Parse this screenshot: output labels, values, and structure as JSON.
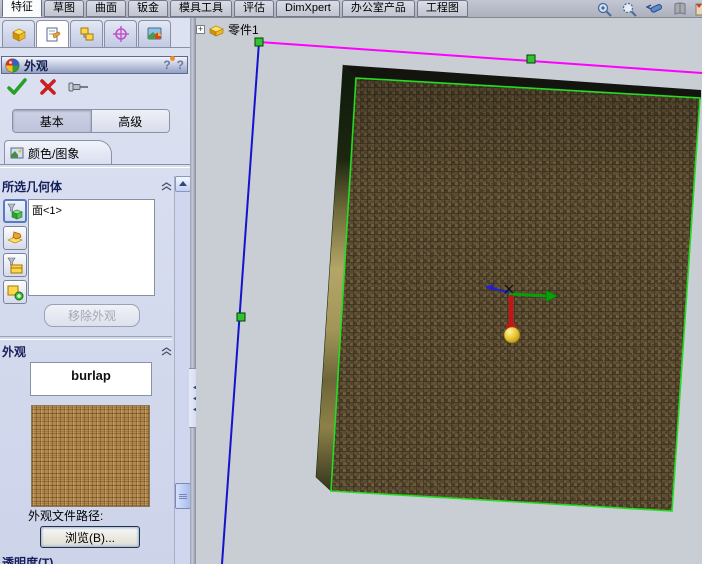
{
  "ribbon": {
    "tabs": [
      {
        "label": "特征",
        "active": true
      },
      {
        "label": "草图",
        "active": false
      },
      {
        "label": "曲面",
        "active": false
      },
      {
        "label": "钣金",
        "active": false
      },
      {
        "label": "模具工具",
        "active": false
      },
      {
        "label": "评估",
        "active": false
      },
      {
        "label": "DimXpert",
        "active": false
      },
      {
        "label": "办公室产品",
        "active": false
      },
      {
        "label": "工程图",
        "active": false
      }
    ],
    "tool_icons": [
      "zoom-in",
      "zoom-to-area",
      "fly-through",
      "appearance-book",
      "texture-file"
    ]
  },
  "panel": {
    "manager_tabs": [
      "feature-manager",
      "property-manager",
      "configuration-manager",
      "dimxpert-manager",
      "display-manager"
    ],
    "active_manager_tab": "property-manager",
    "title": "外观",
    "help_icons": [
      "flyout-help",
      "help"
    ],
    "action_icons": [
      "ok-check",
      "cancel-x",
      "pushpin"
    ],
    "modes": {
      "basic": "基本",
      "advanced": "高级",
      "active": "基本"
    },
    "subtab": "颜色/图象",
    "selected_geometry": {
      "header": "所选几何体",
      "items": [
        "面<1>"
      ],
      "filter_icons": [
        "filter-solid",
        "select-face",
        "filter-body",
        "add-selection"
      ],
      "remove_button": "移除外观",
      "remove_enabled": false
    },
    "appearance": {
      "header": "外观",
      "texture_name": "burlap",
      "path_label": "外观文件路径:",
      "browse_button": "浏览(B)...",
      "transparency_label": "透明度(T)"
    }
  },
  "viewport": {
    "tree_node": "零件1",
    "selection_color": "#22dd22",
    "sketch_horizontal_color": "#ff00ff",
    "sketch_vertical_color": "#1414cc",
    "triad": {
      "x_color": "#c81414",
      "y_color": "#08a008",
      "z_color": "#2020cc",
      "origin_ball_color": "#e8c838"
    }
  }
}
